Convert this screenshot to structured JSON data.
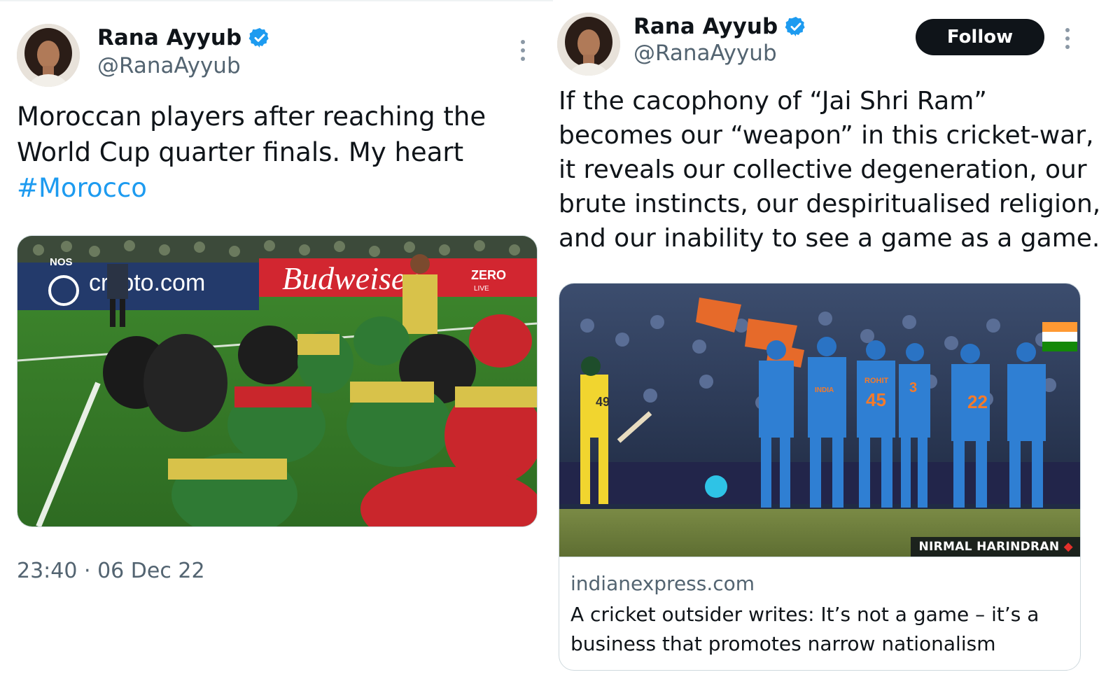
{
  "tweets": [
    {
      "author_name": "Rana Ayyub",
      "handle": "@RanaAyyub",
      "text_lines": [
        "Moroccan players after reaching the",
        "World Cup quarter finals. My heart"
      ],
      "hashtag": "#Morocco",
      "media_alt": "Moroccan football players kneeling in prayer on the pitch",
      "banners": {
        "ad1": "crypto.com",
        "ad2": "Budweiser",
        "ad3": "ZERO",
        "ad4": "LIVE",
        "broadcaster": "NOS"
      },
      "timestamp": "23:40 · 06 Dec 22"
    },
    {
      "author_name": "Rana Ayyub",
      "handle": "@RanaAyyub",
      "follow_label": "Follow",
      "text_lines": [
        "If the cacophony of “Jai Shri Ram”",
        "becomes our “weapon” in this cricket-war,",
        "it reveals our collective degeneration, our",
        "brute instincts, our despiritualised religion,",
        "and our inability to see a game as a game."
      ],
      "media_alt": "Indian cricket team in blue kits celebrating as an Australian batter walks off",
      "jerseys": {
        "batter": "49",
        "bowler": "45",
        "fielder": "22",
        "fielder2": "3",
        "bowler_name": "ROHIT",
        "team": "INDIA"
      },
      "photo_credit": "NIRMAL HARINDRAN",
      "card": {
        "domain": "indianexpress.com",
        "title_lines": [
          "A cricket outsider writes: It’s not a game – it’s a",
          "business that promotes narrow nationalism"
        ]
      }
    }
  ],
  "colors": {
    "link": "#1d9bf0",
    "verified": "#1d9bf0",
    "text": "#0f1419",
    "secondary": "#536471"
  }
}
